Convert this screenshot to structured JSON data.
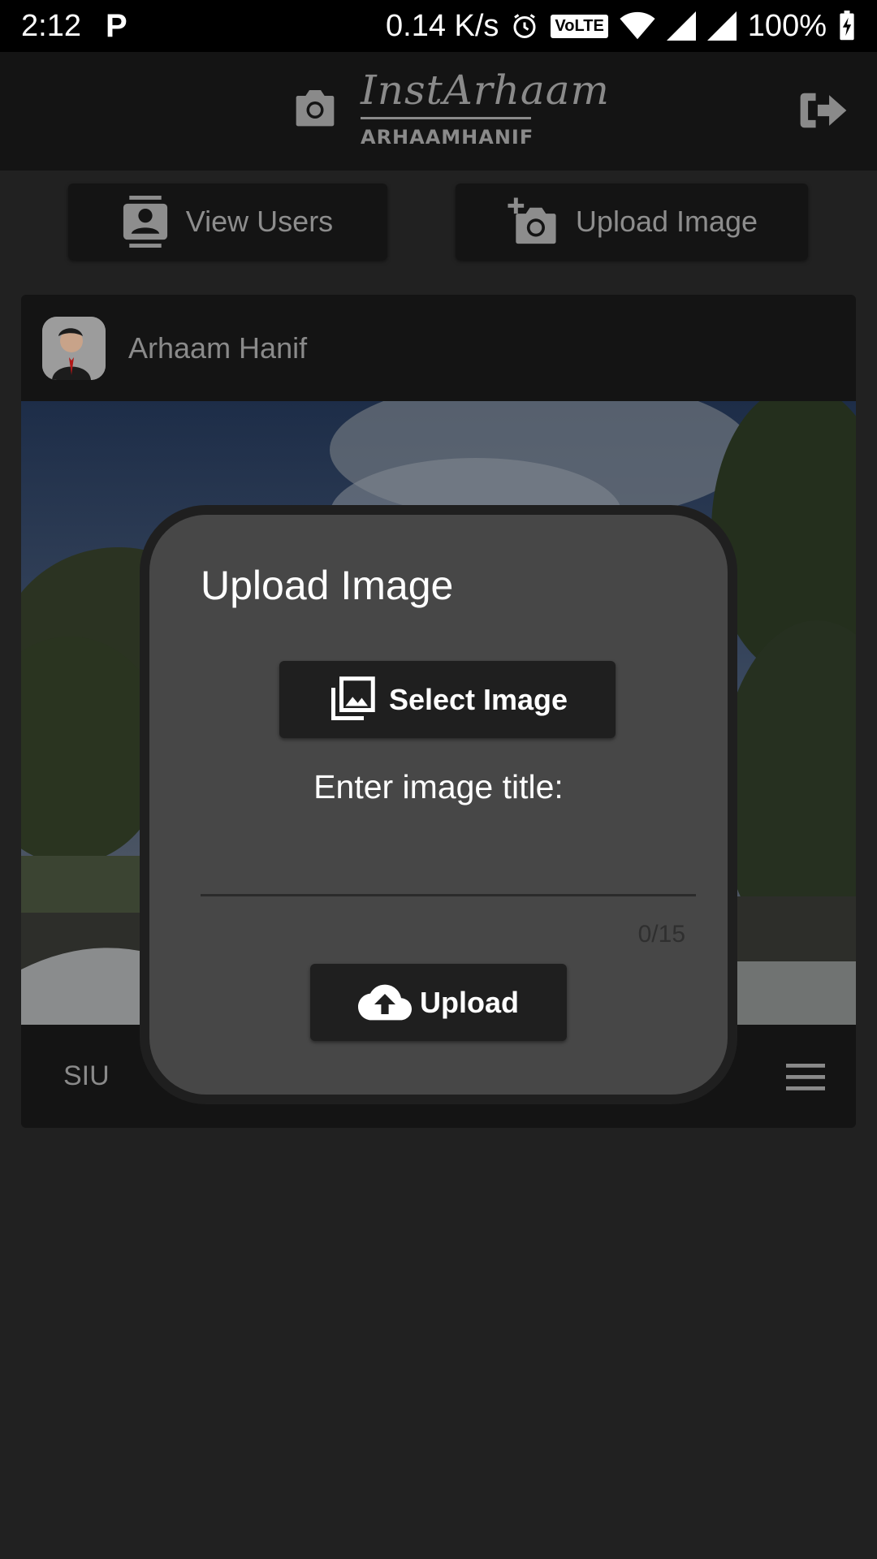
{
  "status_bar": {
    "time": "2:12",
    "p_badge": "P",
    "net_speed": "0.14 K/s",
    "volte": "VoLTE",
    "battery": "100%"
  },
  "app_bar": {
    "brand_title": "InstArhaam",
    "brand_subtitle": "ARHAAMHANIF"
  },
  "actions": {
    "view_users_label": "View Users",
    "upload_image_label": "Upload Image"
  },
  "post": {
    "author": "Arhaam Hanif",
    "caption": "SIU"
  },
  "dialog": {
    "title": "Upload Image",
    "select_label": "Select Image",
    "prompt": "Enter image title:",
    "input_value": "",
    "counter": "0/15",
    "upload_label": "Upload"
  }
}
